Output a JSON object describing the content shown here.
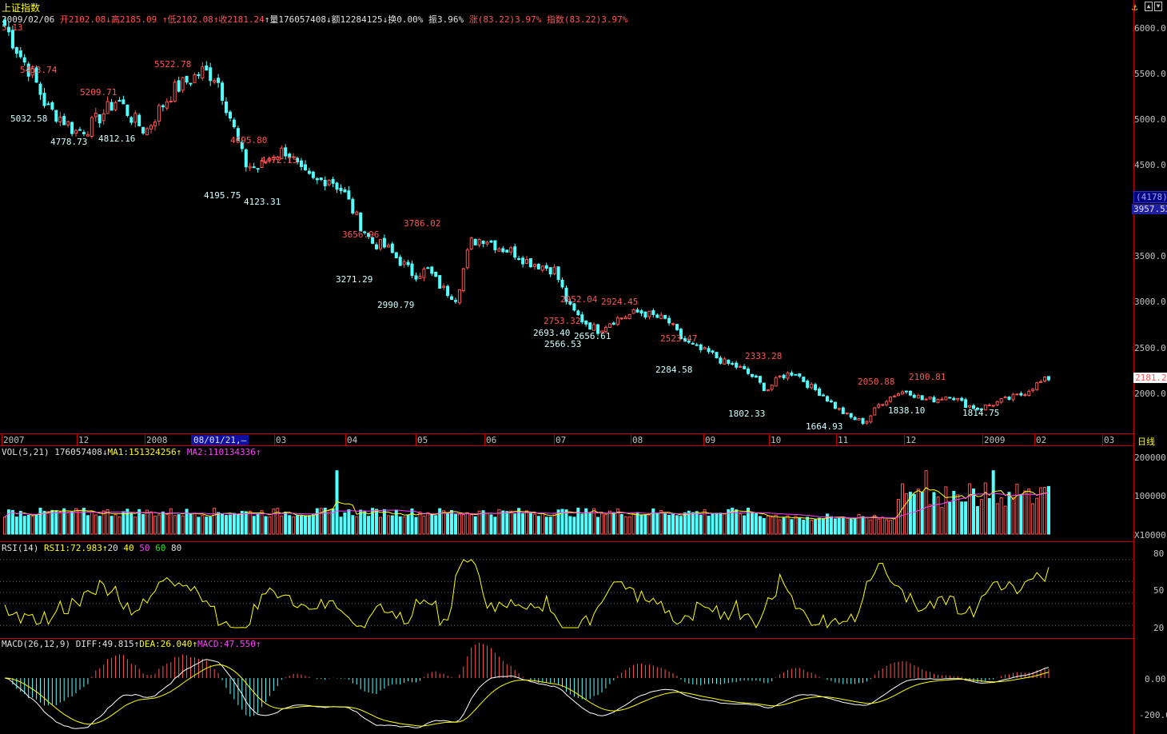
{
  "header": {
    "index_name": "上证指数",
    "date": "2009/02/06",
    "open": "开2102.08",
    "high": "↓高2185.09",
    "low": "↑低2102.08",
    "close": "↑收2181.24",
    "volume": "↑量176057408",
    "amount": "↓额12284125",
    "turnover": "↓换0.00%",
    "amplitude": "振3.96%",
    "change": "涨(83.22)3.97%",
    "index_change": "指数(83.22)3.97%",
    "partial_price": "5.13",
    "anchor_icon": "anchor-icon"
  },
  "price_axis": [
    "6000.0",
    "5500.0",
    "5000.0",
    "4500.0",
    "3500.0",
    "3000.0",
    "2500.0",
    "2000.0"
  ],
  "price_axis_highlight": {
    "count": "(4178)",
    "level": "3957.53",
    "current": "2181.2"
  },
  "time_axis": [
    "2007",
    "12",
    "2008",
    "08/01/21,—",
    "03",
    "04",
    "05",
    "06",
    "07",
    "08",
    "09",
    "10",
    "11",
    "12",
    "2009",
    "02",
    "03"
  ],
  "period": "日线",
  "peak_labels": {
    "high": [
      "5453.74",
      "5209.71",
      "5522.78",
      "4695.80",
      "4472.15",
      "3656.96",
      "3786.02",
      "2952.04",
      "2924.45",
      "2523.47",
      "2333.28",
      "2050.88",
      "2100.81",
      "2753.32"
    ],
    "low": [
      "5032.58",
      "4778.73",
      "4812.16",
      "4195.75",
      "4123.31",
      "3271.29",
      "2990.79",
      "2693.40",
      "2566.53",
      "2656.61",
      "2284.58",
      "1802.33",
      "1664.93",
      "1838.10",
      "1814.75"
    ]
  },
  "vol_panel": {
    "label": "VOL(5,21)",
    "value": "176057408↓",
    "ma1": "MA1:151324256↑",
    "ma2": "MA2:110134336↑",
    "axis": [
      "200000",
      "100000",
      "X10000"
    ]
  },
  "rsi_panel": {
    "label": "RSI(14)",
    "rsi1": "RSI1:72.983↑",
    "levels": [
      "20",
      "40",
      "50",
      "60",
      "80"
    ],
    "axis": [
      "80",
      "50",
      "20"
    ]
  },
  "macd_panel": {
    "label": "MACD(26,12,9)",
    "diff": "DIFF:49.815↑",
    "dea": "DEA:26.040↑",
    "macd": "MACD:47.550↑",
    "axis": [
      "0.00",
      "-200.0"
    ]
  },
  "colors": {
    "up": "#ff5454",
    "down": "#54ffff",
    "ma1": "#ffff00",
    "ma2": "#ff40ff",
    "axis": "#c00000"
  },
  "chart_data": {
    "type": "candlestick",
    "title": "上证指数",
    "price_ylim": [
      1600,
      6100
    ],
    "annotated_extremes": [
      {
        "label": "5453.74",
        "type": "high"
      },
      {
        "label": "5032.58",
        "type": "low"
      },
      {
        "label": "4778.73",
        "type": "low"
      },
      {
        "label": "5209.71",
        "type": "high"
      },
      {
        "label": "4812.16",
        "type": "low"
      },
      {
        "label": "5522.78",
        "type": "high"
      },
      {
        "label": "4195.75",
        "type": "low"
      },
      {
        "label": "4695.80",
        "type": "high"
      },
      {
        "label": "4123.31",
        "type": "low"
      },
      {
        "label": "4472.15",
        "type": "high"
      },
      {
        "label": "3656.96",
        "type": "high"
      },
      {
        "label": "3271.29",
        "type": "low"
      },
      {
        "label": "3786.02",
        "type": "high"
      },
      {
        "label": "2990.79",
        "type": "low"
      },
      {
        "label": "2952.04",
        "type": "high"
      },
      {
        "label": "2693.40",
        "type": "low"
      },
      {
        "label": "2566.53",
        "type": "low"
      },
      {
        "label": "2924.45",
        "type": "high"
      },
      {
        "label": "2656.61",
        "type": "low"
      },
      {
        "label": "2523.47",
        "type": "high"
      },
      {
        "label": "2284.58",
        "type": "low"
      },
      {
        "label": "2333.28",
        "type": "high"
      },
      {
        "label": "1802.33",
        "type": "low"
      },
      {
        "label": "1664.93",
        "type": "low"
      },
      {
        "label": "2050.88",
        "type": "high"
      },
      {
        "label": "1838.10",
        "type": "low"
      },
      {
        "label": "2100.81",
        "type": "high"
      },
      {
        "label": "1814.75",
        "type": "low"
      }
    ],
    "close_trend": [
      6000,
      5700,
      5450,
      5100,
      5000,
      4850,
      4900,
      5050,
      5200,
      5000,
      4850,
      5100,
      5300,
      5400,
      5500,
      5450,
      5000,
      4500,
      4450,
      4600,
      4650,
      4400,
      4300,
      4350,
      4200,
      3900,
      3650,
      3600,
      3450,
      3300,
      3350,
      3150,
      3050,
      3650,
      3700,
      3600,
      3550,
      3450,
      3400,
      3350,
      2950,
      2800,
      2700,
      2800,
      2850,
      2900,
      2850,
      2800,
      2600,
      2500,
      2450,
      2350,
      2300,
      2200,
      2050,
      2200,
      2250,
      2100,
      2000,
      1850,
      1750,
      1700,
      1900,
      2000,
      2050,
      1950,
      1950,
      2000,
      1900,
      1850,
      1900,
      1950,
      2000,
      2100,
      2180
    ]
  }
}
